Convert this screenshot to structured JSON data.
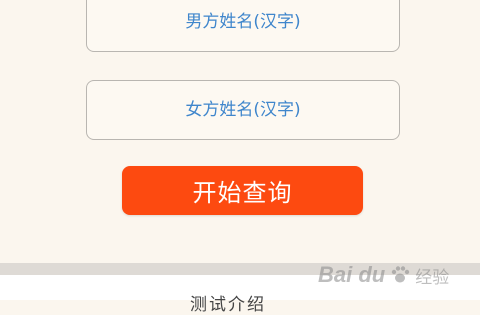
{
  "form": {
    "male_name_placeholder": "男方姓名(汉字)",
    "female_name_placeholder": "女方姓名(汉字)",
    "submit_label": "开始查询"
  },
  "section": {
    "title": "测试介绍"
  },
  "watermark": {
    "brand": "Bai du",
    "product": "经验",
    "icon": "paw-icon"
  }
}
